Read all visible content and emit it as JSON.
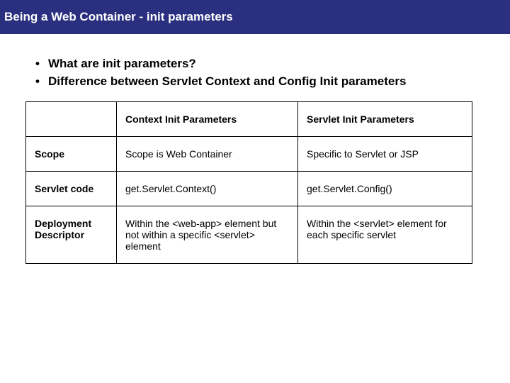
{
  "header": {
    "title": "Being a Web Container - init parameters"
  },
  "bullets": [
    "What are init parameters?",
    "Difference between Servlet Context and Config Init parameters"
  ],
  "table": {
    "corner": "",
    "col_headers": [
      "Context Init Parameters",
      "Servlet Init Parameters"
    ],
    "rows": [
      {
        "label": "Scope",
        "cells": [
          "Scope is Web Container",
          "Specific to Servlet or JSP"
        ]
      },
      {
        "label": "Servlet code",
        "cells": [
          "get.Servlet.Context()",
          "get.Servlet.Config()"
        ]
      },
      {
        "label": "Deployment Descriptor",
        "cells": [
          "Within the <web-app> element but not within a specific <servlet> element",
          "Within the <servlet> element for each specific servlet"
        ]
      }
    ]
  }
}
